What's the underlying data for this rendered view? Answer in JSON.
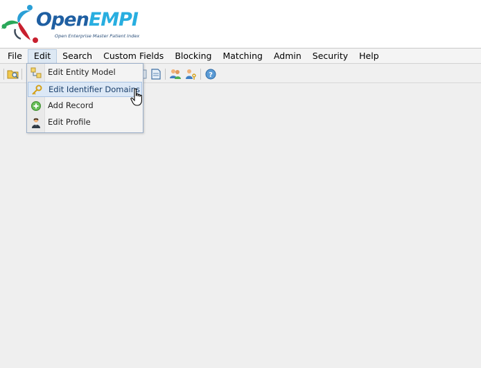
{
  "logo": {
    "title_open": "Open",
    "title_empi": "EMPI",
    "subtitle": "Open Enterprise Master Patient Index"
  },
  "menubar": {
    "items": [
      {
        "label": "File"
      },
      {
        "label": "Edit"
      },
      {
        "label": "Search"
      },
      {
        "label": "Custom Fields"
      },
      {
        "label": "Blocking"
      },
      {
        "label": "Matching"
      },
      {
        "label": "Admin"
      },
      {
        "label": "Security"
      },
      {
        "label": "Help"
      }
    ],
    "active": "Edit"
  },
  "edit_menu": {
    "items": [
      {
        "label": "Edit Entity Model",
        "icon": "entity-model-icon"
      },
      {
        "label": "Edit Identifier Domains",
        "icon": "key-icon"
      },
      {
        "label": "Add Record",
        "icon": "add-green-icon"
      },
      {
        "label": "Edit Profile",
        "icon": "user-profile-icon"
      }
    ],
    "hovered": "Edit Identifier Domains"
  },
  "toolbar": {
    "icons": [
      "folder-search-icon",
      "entity-icon",
      "document-icon",
      "users-icon",
      "user-key-icon",
      "help-icon"
    ]
  },
  "colors": {
    "brand_dark_blue": "#1f5fa2",
    "brand_light_blue": "#28aee0",
    "background": "#efefef",
    "hover_blue": "#dce8f6"
  }
}
